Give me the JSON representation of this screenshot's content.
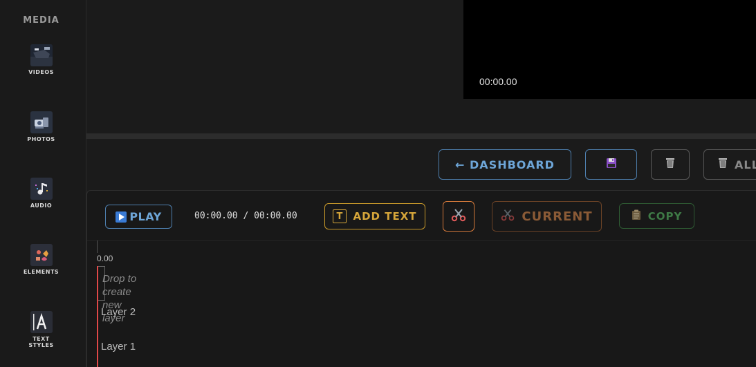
{
  "sidebar": {
    "title": "MEDIA",
    "items": [
      {
        "label": "VIDEOS",
        "icon": "video-thumb-icon"
      },
      {
        "label": "PHOTOS",
        "icon": "photo-thumb-icon"
      },
      {
        "label": "AUDIO",
        "icon": "music-note-icon"
      },
      {
        "label": "ELEMENTS",
        "icon": "elements-icon"
      },
      {
        "label": "TEXT",
        "label2": "STYLES",
        "icon": "text-style-icon"
      }
    ]
  },
  "preview": {
    "time": "00:00.00"
  },
  "actions": {
    "dashboard_label": "← DASHBOARD",
    "save_icon": "floppy-disk-icon",
    "delete_icon": "trash-icon",
    "delete_all_label": "ALL"
  },
  "timeline": {
    "play_label": "PLAY",
    "timecode": "00:00.00 / 00:00.00",
    "add_text_label": "ADD TEXT",
    "add_text_glyph": "T",
    "split_icon": "scissors-icon",
    "cut_current_label": "CURRENT",
    "copy_label": "COPY",
    "ruler_start": "0.00",
    "drop_hint": "Drop to create new layer",
    "layers": [
      {
        "label": "Layer 2"
      },
      {
        "label": "Layer 1"
      }
    ]
  },
  "colors": {
    "accent_blue": "#6ea6d8",
    "accent_gold": "#d6a63a",
    "accent_orange": "#d4793a",
    "accent_green": "#3e7a46",
    "playhead_red": "#e04848"
  }
}
